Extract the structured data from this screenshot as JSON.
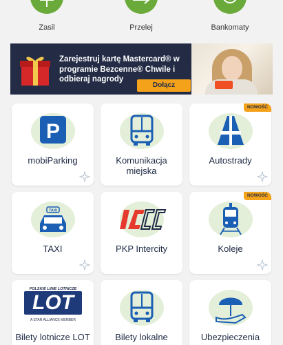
{
  "quick_actions": [
    {
      "label": "Zasil",
      "icon": "plus-icon"
    },
    {
      "label": "Przelej",
      "icon": "arrow-right-icon"
    },
    {
      "label": "Bankomaty",
      "icon": "dollar-coin-icon"
    }
  ],
  "banner": {
    "text": "Zarejestruj kartę Mastercard® w programie Bezcenne® Chwile i odbieraj nagrody",
    "button_label": "Dołącz"
  },
  "tiles": [
    {
      "label": "mobiParking",
      "icon": "parking-icon",
      "badge": ""
    },
    {
      "label": "Komunikacja miejska",
      "icon": "bus-icon",
      "badge": ""
    },
    {
      "label": "Autostrady",
      "icon": "highway-icon",
      "badge": "NOWOŚĆ"
    },
    {
      "label": "TAXI",
      "icon": "taxi-icon",
      "badge": ""
    },
    {
      "label": "PKP Intercity",
      "icon": "intercity-logo",
      "badge": ""
    },
    {
      "label": "Koleje",
      "icon": "train-icon",
      "badge": "NOWOŚĆ"
    },
    {
      "label": "Bilety lotnicze LOT",
      "icon": "lot-logo",
      "badge": ""
    },
    {
      "label": "Bilety lokalne",
      "icon": "bus-icon",
      "badge": ""
    },
    {
      "label": "Ubezpieczenia",
      "icon": "umbrella-hand-icon",
      "badge": ""
    }
  ],
  "lot_logo": {
    "top_text": "POLSKIE LINIE LOTNICZE",
    "word": "LOT",
    "bottom_text": "A STAR ALLIANCE MEMBER"
  },
  "taxi_sign": "TAXI",
  "colors": {
    "green": "#6aaa3a",
    "navy": "#1e2a44",
    "blue": "#1b5fb5",
    "orange": "#f5a21b",
    "red": "#e63a2e"
  }
}
